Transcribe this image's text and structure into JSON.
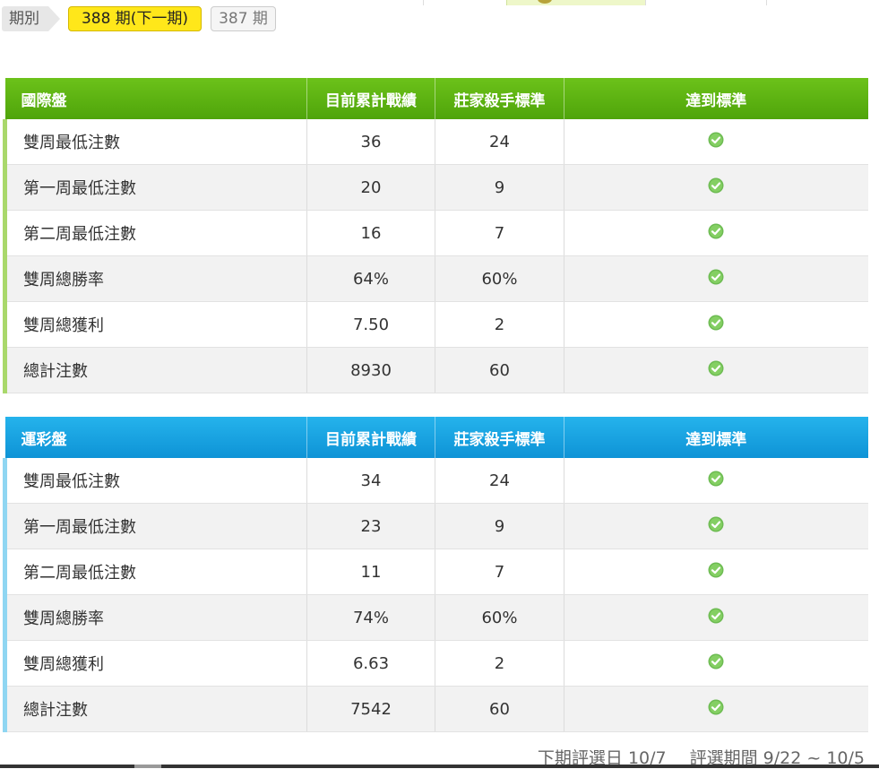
{
  "periods": {
    "label": "期別",
    "active": "388 期(下一期)",
    "other": "387 期"
  },
  "tables": [
    {
      "title": "國際盤",
      "headers": [
        "目前累計戰績",
        "莊家殺手標準",
        "達到標準"
      ],
      "accent": "#5bb311",
      "rows": [
        {
          "label": "雙周最低注數",
          "current": "36",
          "standard": "24",
          "met": true
        },
        {
          "label": "第一周最低注數",
          "current": "20",
          "standard": "9",
          "met": true
        },
        {
          "label": "第二周最低注數",
          "current": "16",
          "standard": "7",
          "met": true
        },
        {
          "label": "雙周總勝率",
          "current": "64%",
          "standard": "60%",
          "met": true
        },
        {
          "label": "雙周總獲利",
          "current": "7.50",
          "standard": "2",
          "met": true
        },
        {
          "label": "總計注數",
          "current": "8930",
          "standard": "60",
          "met": true
        }
      ]
    },
    {
      "title": "運彩盤",
      "headers": [
        "目前累計戰績",
        "莊家殺手標準",
        "達到標準"
      ],
      "accent": "#16a2e1",
      "rows": [
        {
          "label": "雙周最低注數",
          "current": "34",
          "standard": "24",
          "met": true
        },
        {
          "label": "第一周最低注數",
          "current": "23",
          "standard": "9",
          "met": true
        },
        {
          "label": "第二周最低注數",
          "current": "11",
          "standard": "7",
          "met": true
        },
        {
          "label": "雙周總勝率",
          "current": "74%",
          "standard": "60%",
          "met": true
        },
        {
          "label": "雙周總獲利",
          "current": "6.63",
          "standard": "2",
          "met": true
        },
        {
          "label": "總計注數",
          "current": "7542",
          "standard": "60",
          "met": true
        }
      ]
    }
  ],
  "footer": {
    "next_selection": "下期評選日 10/7",
    "selection_period": "評選期間 9/22 ~ 10/5"
  },
  "icons": {
    "check": "check-circle-icon"
  },
  "colors": {
    "check": "#6dbb52",
    "active_period": "#ffe71a"
  }
}
